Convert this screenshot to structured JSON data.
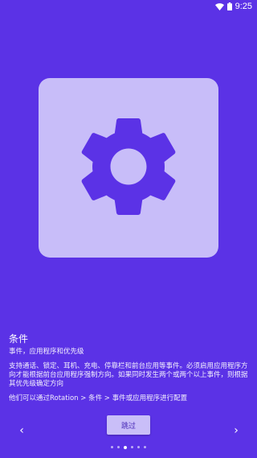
{
  "status_bar": {
    "time": "9:25",
    "wifi_icon": "wifi-icon",
    "battery_icon": "battery-icon"
  },
  "hero": {
    "icon": "gear-icon",
    "tile_color": "#c8bdf9",
    "gear_color": "#5b32e6"
  },
  "content": {
    "title": "条件",
    "subtitle": "事件，应用程序和优先级",
    "body": "支持通话、锁定、耳机、充电、停靠栏和前台应用等事件。必须启用应用程序方向才能根据前台应用程序强制方向。如果同时发生两个或两个以上事件，则根据其优先级确定方向",
    "config_hint": "他们可以通过Rotation > 条件 > 事件或应用程序进行配置"
  },
  "nav": {
    "prev_icon": "chevron-left-icon",
    "prev_glyph": "‹",
    "next_icon": "chevron-right-icon",
    "next_glyph": "›",
    "skip_label": "跳过"
  },
  "pager": {
    "total": 6,
    "active_index": 2
  },
  "colors": {
    "background": "#5b32e6",
    "accent": "#c9bef8"
  }
}
